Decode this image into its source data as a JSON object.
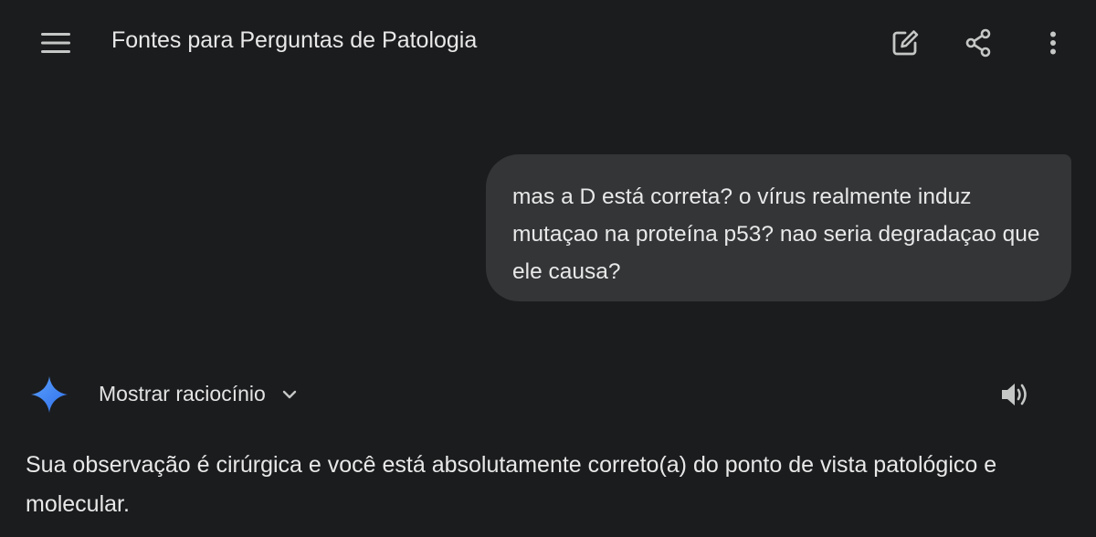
{
  "header": {
    "title": "Fontes para Perguntas de Patologia",
    "menu_icon": "hamburger-menu-icon",
    "edit_icon": "edit-icon",
    "share_icon": "share-icon",
    "more_icon": "more-vert-icon"
  },
  "conversation": {
    "user_message": "mas a D está correta? o vírus realmente induz mutaçao na proteína p53? nao seria degradaçao que ele causa?",
    "assistant": {
      "avatar_icon": "gemini-sparkle-icon",
      "reasoning_toggle_label": "Mostrar raciocínio",
      "speaker_icon": "volume-icon",
      "response_text": "Sua observação é cirúrgica e você está absolutamente correto(a) do ponto de vista patológico e molecular."
    }
  },
  "colors": {
    "background": "#1b1c1e",
    "bubble": "#333537",
    "text": "#e3e3e3",
    "sparkle_blue": "#4285f4"
  }
}
